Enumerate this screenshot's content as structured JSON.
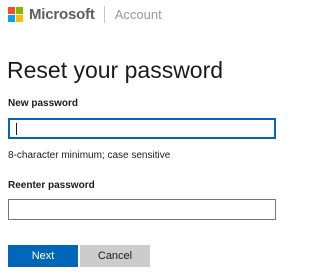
{
  "header": {
    "brand": "Microsoft",
    "section": "Account",
    "logo_colors": [
      "#f25022",
      "#7fba00",
      "#00a4ef",
      "#ffb900"
    ]
  },
  "main": {
    "title": "Reset your password",
    "new_password": {
      "label": "New password",
      "value": "",
      "focused": true
    },
    "hint": "8-character minimum; case sensitive",
    "reenter_password": {
      "label": "Reenter password",
      "value": ""
    }
  },
  "actions": {
    "next_label": "Next",
    "cancel_label": "Cancel"
  },
  "colors": {
    "accent": "#0067b8",
    "secondary_button": "#cccccc"
  }
}
